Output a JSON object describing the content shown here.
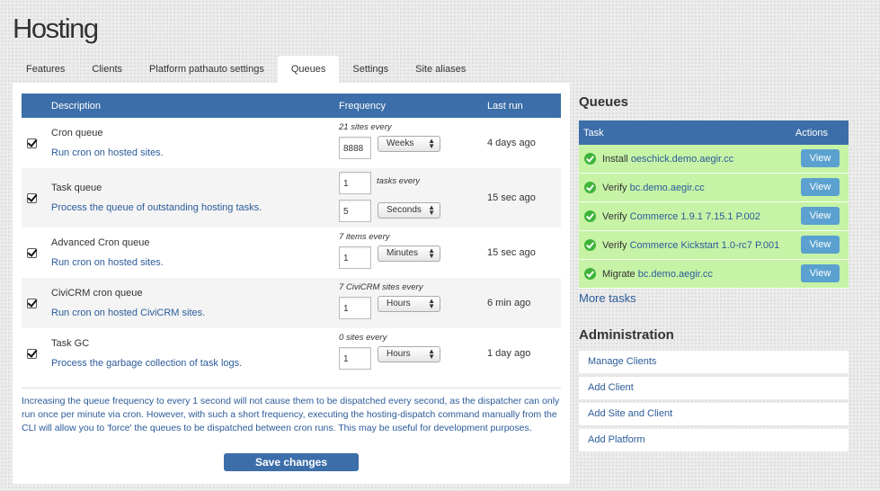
{
  "page_title": "Hosting",
  "tabs": [
    {
      "label": "Features"
    },
    {
      "label": "Clients"
    },
    {
      "label": "Platform pathauto settings"
    },
    {
      "label": "Queues"
    },
    {
      "label": "Settings"
    },
    {
      "label": "Site aliases"
    }
  ],
  "active_tab": "Queues",
  "table": {
    "headers": {
      "description": "Description",
      "frequency": "Frequency",
      "last_run": "Last run"
    }
  },
  "queues": [
    {
      "name": "Cron queue",
      "desc": "Run cron on hosted sites.",
      "label_pre": "21",
      "label_post": "sites every",
      "items": "8888",
      "unit": "Weeks",
      "last_run": "4 days ago",
      "checked": true
    },
    {
      "name": "Task queue",
      "desc": "Process the queue of outstanding hosting tasks.",
      "items": "1",
      "label_post": "tasks every",
      "interval": "5",
      "unit": "Seconds",
      "last_run": "15 sec ago",
      "checked": true
    },
    {
      "name": "Advanced Cron queue",
      "desc": "Run cron on hosted sites.",
      "label_pre": "7",
      "label_post": "items every",
      "interval": "1",
      "unit": "Minutes",
      "last_run": "15 sec ago",
      "checked": true
    },
    {
      "name": "CiviCRM cron queue",
      "desc": "Run cron on hosted CiviCRM sites.",
      "label_pre": "7",
      "label_post": "CiviCRM sites every",
      "interval": "1",
      "unit": "Hours",
      "last_run": "6 min ago",
      "checked": true
    },
    {
      "name": "Task GC",
      "desc": "Process the garbage collection of task logs.",
      "label_pre": "0",
      "label_post": "sites every",
      "interval": "1",
      "unit": "Hours",
      "last_run": "1 day ago",
      "checked": true
    }
  ],
  "note": "Increasing the queue frequency to every 1 second will not cause them to be dispatched every second, as the dispatcher can only run once per minute via cron. However, with such a short frequency, executing the hosting-dispatch command manually from the CLI will allow you to 'force' the queues to be dispatched between cron runs. This may be useful for development purposes.",
  "save_label": "Save changes",
  "sidebar": {
    "queues_title": "Queues",
    "task_headers": {
      "task": "Task",
      "actions": "Actions"
    },
    "tasks": [
      {
        "action": "Install",
        "target": "oeschick.demo.aegir.cc",
        "button": "View"
      },
      {
        "action": "Verify",
        "target": "bc.demo.aegir.cc",
        "button": "View"
      },
      {
        "action": "Verify",
        "target": "Commerce 1.9.1 7.15.1 P.002",
        "button": "View"
      },
      {
        "action": "Verify",
        "target": "Commerce Kickstart 1.0-rc7 P.001",
        "button": "View"
      },
      {
        "action": "Migrate",
        "target": "bc.demo.aegir.cc",
        "button": "View"
      }
    ],
    "more_tasks": "More tasks",
    "admin_title": "Administration",
    "admin_links": [
      {
        "label": "Manage Clients"
      },
      {
        "label": "Add Client"
      },
      {
        "label": "Add Site and Client"
      },
      {
        "label": "Add Platform"
      }
    ]
  },
  "colors": {
    "header_blue": "#3c6ea9",
    "link_blue": "#2b5b9a",
    "task_green": "#c6f3a6",
    "view_button": "#5aa1cf",
    "success_icon": "#3fb33a"
  }
}
